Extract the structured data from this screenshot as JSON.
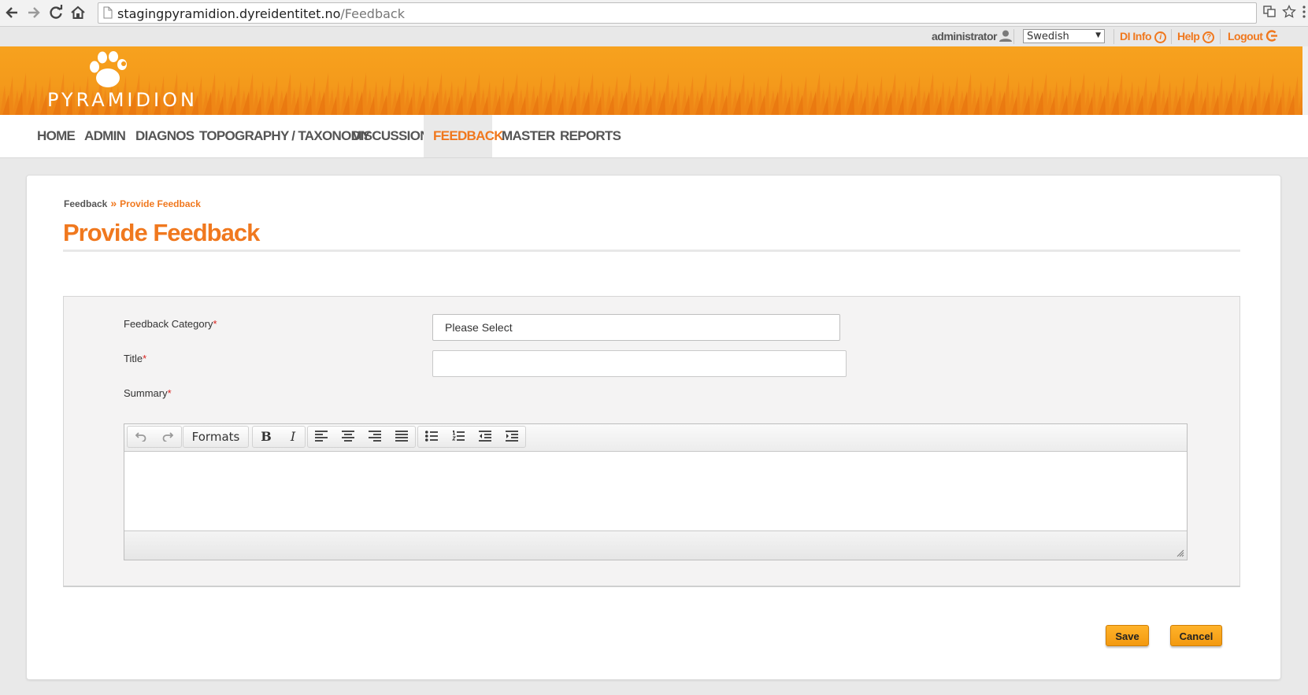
{
  "browser": {
    "url_host": "stagingpyramidion.dyreidentitet.no",
    "url_path": "/Feedback"
  },
  "user_bar": {
    "username": "administrator",
    "language": "Swedish",
    "di_info": "DI Info",
    "help": "Help",
    "logout": "Logout"
  },
  "banner": {
    "logo_text": "PYRAMIDION"
  },
  "nav": {
    "items": [
      {
        "label": "HOME"
      },
      {
        "label": "ADMIN"
      },
      {
        "label": "DIAGNOS"
      },
      {
        "label": "TOPOGRAPHY / TAXONOMY"
      },
      {
        "label": "DISCUSSION"
      },
      {
        "label": "FEEDBACK"
      },
      {
        "label": "MASTER"
      },
      {
        "label": "REPORTS"
      }
    ],
    "active": "FEEDBACK"
  },
  "breadcrumb": {
    "root": "Feedback",
    "separator": "»",
    "current": "Provide Feedback"
  },
  "page": {
    "title": "Provide Feedback"
  },
  "form": {
    "category_label": "Feedback Category",
    "category_value": "Please Select",
    "title_label": "Title",
    "title_value": "",
    "summary_label": "Summary",
    "required_mark": "*"
  },
  "editor": {
    "formats_label": "Formats"
  },
  "actions": {
    "save": "Save",
    "cancel": "Cancel"
  },
  "colors": {
    "accent": "#f0781e",
    "banner": "#f49a1b",
    "required": "#d9231f"
  }
}
